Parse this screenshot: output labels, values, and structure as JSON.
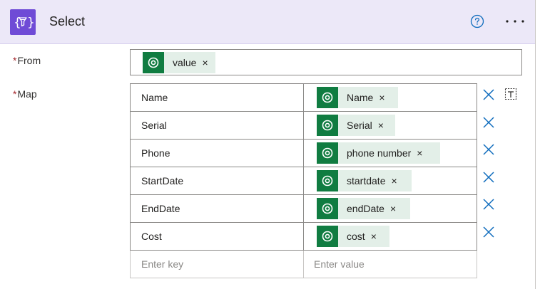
{
  "header": {
    "title": "Select",
    "icon": "variable-braces-icon",
    "accent": "#6f4bd6",
    "help_label": "?",
    "more_label": "···"
  },
  "from": {
    "label": "From",
    "required_mark": "*",
    "token": {
      "text": "value",
      "close": "×",
      "icon": "dataverse-icon"
    }
  },
  "map": {
    "label": "Map",
    "required_mark": "*",
    "rows": [
      {
        "key": "Name",
        "value": "Name",
        "close": "×"
      },
      {
        "key": "Serial",
        "value": "Serial",
        "close": "×"
      },
      {
        "key": "Phone",
        "value": "phone number",
        "close": "×"
      },
      {
        "key": "StartDate",
        "value": "startdate",
        "close": "×"
      },
      {
        "key": "EndDate",
        "value": "endDate",
        "close": "×"
      },
      {
        "key": "Cost",
        "value": "cost",
        "close": "×"
      }
    ],
    "new_row": {
      "key_placeholder": "Enter key",
      "value_placeholder": "Enter value"
    },
    "token_color": "#107c41",
    "token_bg": "#e3efe8",
    "delete_color": "#0f6cbd"
  }
}
